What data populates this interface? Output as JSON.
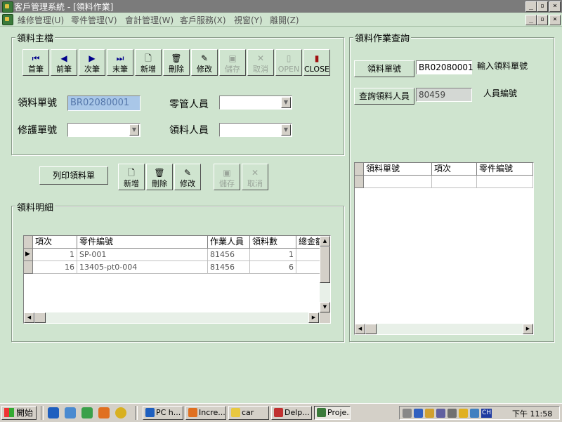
{
  "window": {
    "title": "客戶管理系統 - [領料作業]"
  },
  "menu": [
    "維修管理(U)",
    "零件管理(V)",
    "會計管理(W)",
    "客戶服務(X)",
    "視窗(Y)",
    "離開(Z)"
  ],
  "master": {
    "title": "領料主檔",
    "toolbar": [
      {
        "label": "首筆",
        "icon": "first-record-icon"
      },
      {
        "label": "前筆",
        "icon": "previous-record-icon"
      },
      {
        "label": "次筆",
        "icon": "next-record-icon"
      },
      {
        "label": "末筆",
        "icon": "last-record-icon"
      },
      {
        "label": "新增",
        "icon": "new-document-icon"
      },
      {
        "label": "刪除",
        "icon": "trash-icon"
      },
      {
        "label": "修改",
        "icon": "edit-icon"
      },
      {
        "label": "儲存",
        "icon": "save-icon"
      },
      {
        "label": "取消",
        "icon": "cancel-icon"
      },
      {
        "label": "OPEN",
        "icon": "open-door-icon"
      },
      {
        "label": "CLOSE",
        "icon": "close-door-icon"
      }
    ],
    "fields": {
      "pick_no_label": "領料單號",
      "pick_no_value": "BR02080001",
      "parts_staff_label": "零管人員",
      "repair_no_label": "修護單號",
      "pick_staff_label": "領料人員"
    }
  },
  "print_button": "列印領料單",
  "detail_toolbar": [
    {
      "label": "新增",
      "icon": "new-document-icon"
    },
    {
      "label": "刪除",
      "icon": "trash-icon"
    },
    {
      "label": "修改",
      "icon": "edit-icon"
    },
    {
      "label": "儲存",
      "icon": "save-icon"
    },
    {
      "label": "取消",
      "icon": "cancel-icon"
    }
  ],
  "detail": {
    "title": "領料明細",
    "columns": [
      "項次",
      "零件編號",
      "作業人員",
      "領料數",
      "總金額"
    ],
    "rows": [
      [
        "1",
        "SP-001",
        "81456",
        "1",
        ""
      ],
      [
        "16",
        "13405-pt0-004",
        "81456",
        "6",
        ""
      ]
    ]
  },
  "query": {
    "title": "領料作業查詢",
    "pick_no_button": "領料單號",
    "pick_no_value": "BR02080001",
    "pick_no_hint": "輸入領料單號",
    "staff_button": "查詢領料人員",
    "staff_value": "80459",
    "staff_hint": "人員編號",
    "columns": [
      "領料單號",
      "項次",
      "零件編號"
    ]
  },
  "taskbar": {
    "start": "開始",
    "tasks": [
      "PC h...",
      "Incre...",
      "car",
      "Delp...",
      "Proje..."
    ],
    "clock": "下午 11:58",
    "lang": "CH"
  },
  "colors": {
    "background": "#cfe4cf",
    "title_bar": "#7b7b7b",
    "highlight_input": "#a9c7e8"
  }
}
